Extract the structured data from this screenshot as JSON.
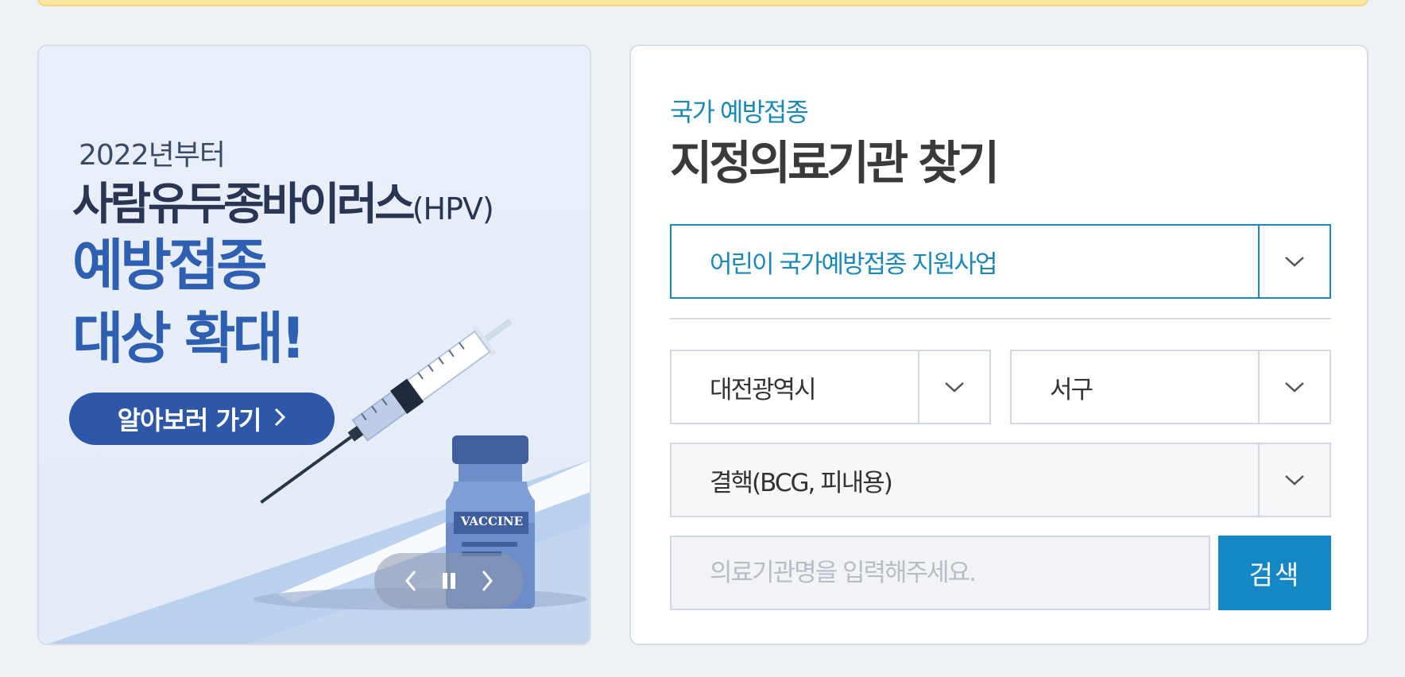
{
  "banner": {
    "year_text": "2022년부터",
    "title_text": "사람유두종바이러스",
    "title_suffix": "(HPV)",
    "main_line1": "예방접종",
    "main_line2": "대상 확대!",
    "more_label": "알아보러 가기",
    "vial_label": "VACCINE"
  },
  "finder": {
    "subtitle": "국가 예방접종",
    "title": "지정의료기관 찾기",
    "program_select": "어린이 국가예방접종 지원사업",
    "city_select": "대전광역시",
    "district_select": "서구",
    "vaccine_select": "결핵(BCG, 피내용)",
    "search_placeholder": "의료기관명을 입력해주세요.",
    "search_button": "검색"
  },
  "colors": {
    "accent": "#1a89b8",
    "button_blue": "#1687c5",
    "banner_blue": "#2f5fb0",
    "banner_navy": "#2a3554"
  }
}
